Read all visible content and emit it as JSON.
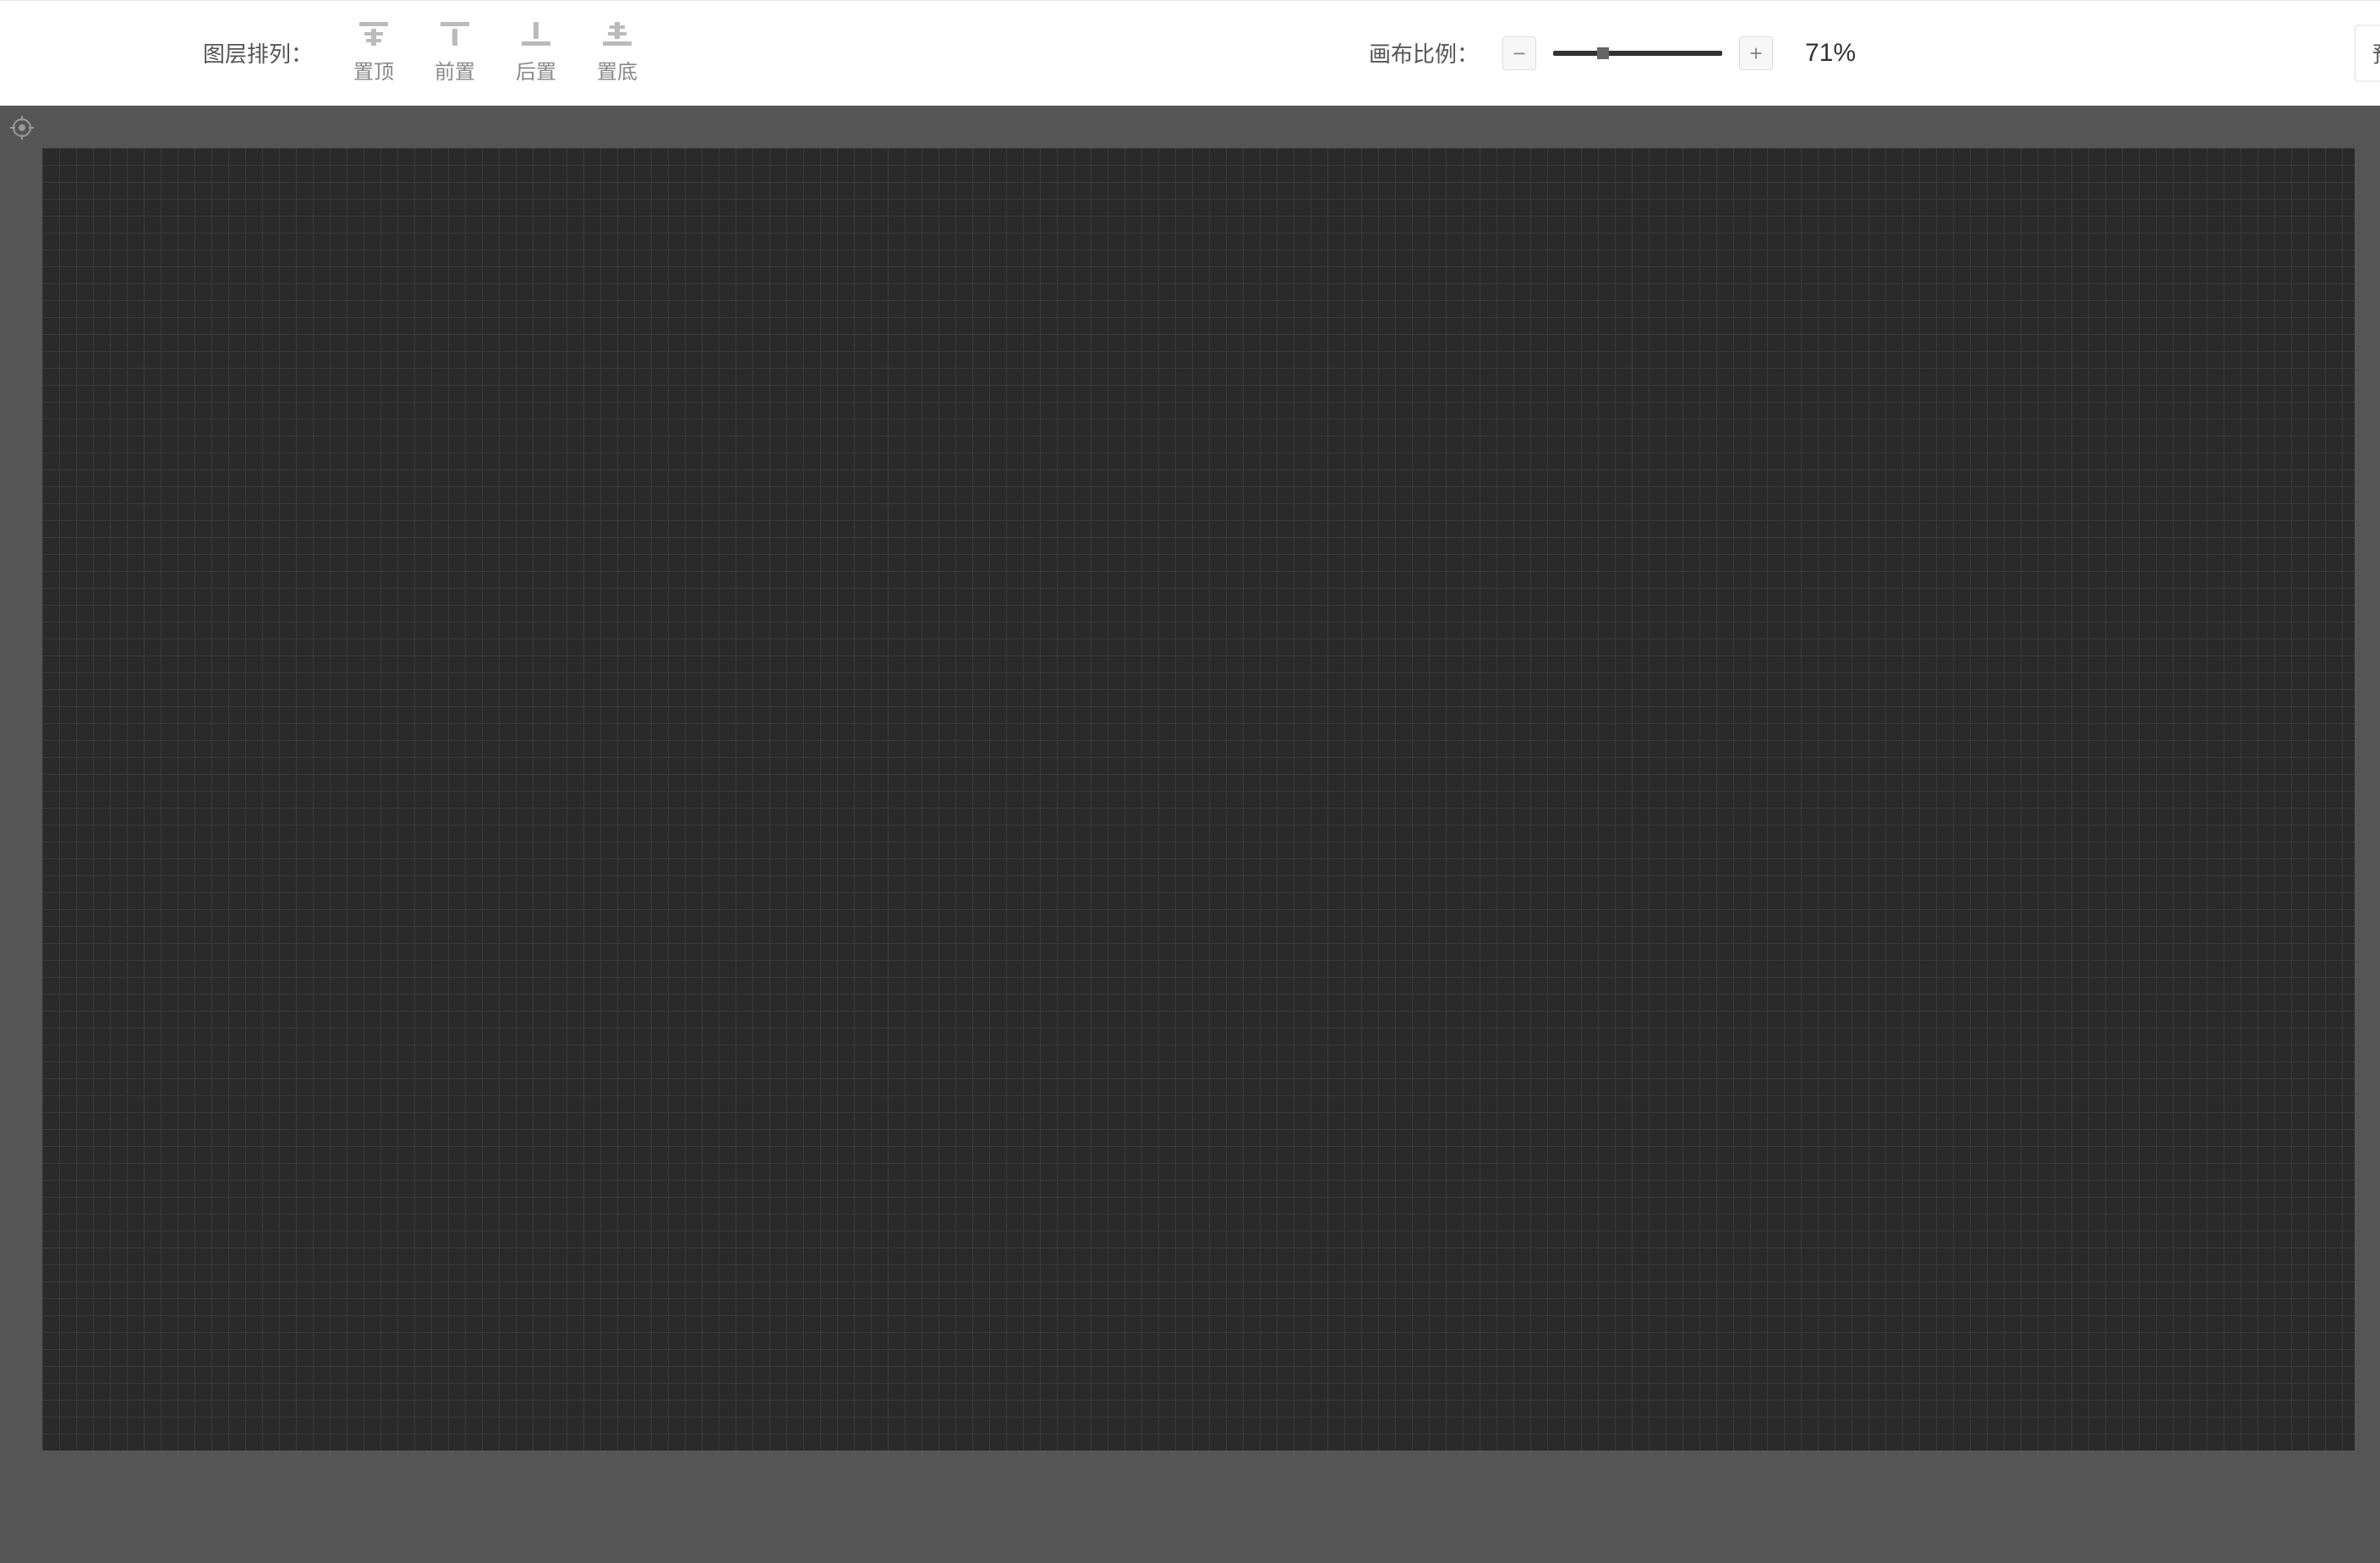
{
  "toolbar": {
    "layer_label": "图层排列：",
    "buttons": [
      {
        "id": "bring-to-top",
        "label": "置顶"
      },
      {
        "id": "bring-forward",
        "label": "前置"
      },
      {
        "id": "send-backward",
        "label": "后置"
      },
      {
        "id": "send-to-bottom",
        "label": "置底"
      }
    ],
    "zoom_label": "画布比例：",
    "zoom_value": "71%",
    "right_button": "预"
  }
}
